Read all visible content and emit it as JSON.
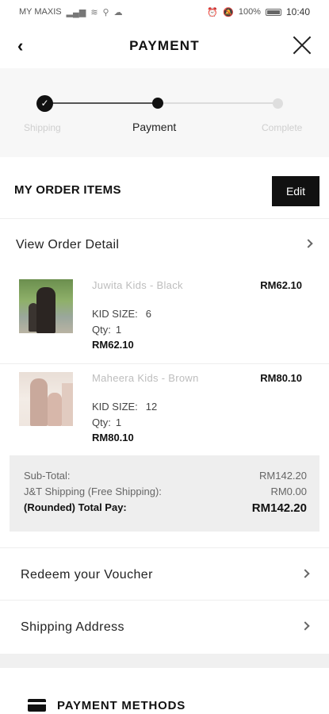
{
  "status_bar": {
    "carrier": "MY MAXIS",
    "battery": "100%",
    "time": "10:40"
  },
  "header": {
    "title": "PAYMENT",
    "back_icon": "chevron-left-icon",
    "close_icon": "close-icon"
  },
  "stepper": {
    "steps": [
      {
        "label": "Shipping",
        "state": "done"
      },
      {
        "label": "Payment",
        "state": "active"
      },
      {
        "label": "Complete",
        "state": "pending"
      }
    ]
  },
  "order_items": {
    "title": "MY ORDER ITEMS",
    "edit_label": "Edit",
    "view_detail_label": "View Order Detail"
  },
  "products": [
    {
      "name": "Juwita Kids - Black",
      "price": "RM62.10",
      "size_label": "KID SIZE:",
      "size_value": "6",
      "qty_label": "Qty:",
      "qty_value": "1",
      "total": "RM62.10"
    },
    {
      "name": "Maheera Kids - Brown",
      "price": "RM80.10",
      "size_label": "KID SIZE:",
      "size_value": "12",
      "qty_label": "Qty:",
      "qty_value": "1",
      "total": "RM80.10"
    }
  ],
  "summary": {
    "subtotal_label": "Sub-Total:",
    "subtotal_value": "RM142.20",
    "shipping_label": "J&T Shipping (Free Shipping):",
    "shipping_value": "RM0.00",
    "total_label": "(Rounded) Total Pay:",
    "total_value": "RM142.20"
  },
  "links": {
    "voucher": "Redeem your Voucher",
    "address": "Shipping Address"
  },
  "payment_methods": {
    "title": "PAYMENT METHODS",
    "icon": "credit-card-icon"
  }
}
